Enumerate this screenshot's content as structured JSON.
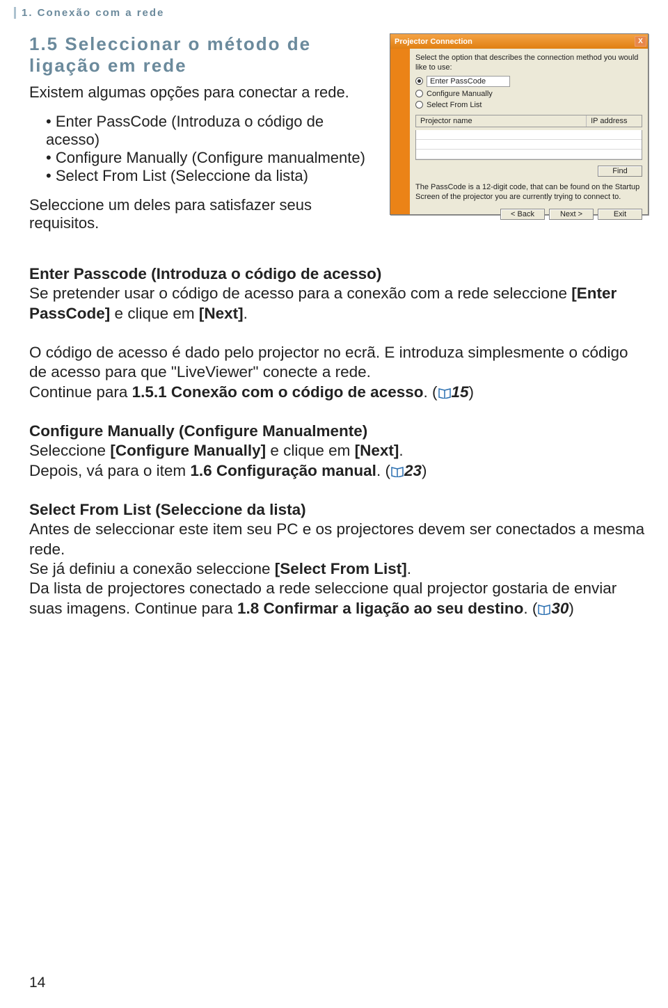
{
  "breadcrumb": "1. Conexão com a rede",
  "heading": "1.5 Seleccionar o método de ligação em rede",
  "intro": "Existem algumas opções para conectar a rede.",
  "bullets": [
    "Enter PassCode (Introduza o código de acesso)",
    "Configure Manually (Configure manualmente)",
    "Select From List (Seleccione da lista)"
  ],
  "after_bullets": "Seleccione um deles para satisfazer seus requisitos.",
  "dialog": {
    "title": "Projector Connection",
    "close": "X",
    "prompt": "Select the option that describes the connection method you would like to use:",
    "opt1": "Enter PassCode",
    "opt2": "Configure Manually",
    "opt3": "Select From List",
    "col1": "Projector name",
    "col2": "IP address",
    "find": "Find",
    "note": "The PassCode is a 12-digit code, that can be found on the Startup Screen of the projector you are currently trying to connect to.",
    "back": "< Back",
    "next": "Next >",
    "exit": "Exit"
  },
  "sec1_title": "Enter Passcode (Introduza o código de acesso)",
  "sec1_body_a": "Se pretender usar o código de acesso para a conexão com a rede seleccione ",
  "sec1_body_b": "[Enter PassCode]",
  "sec1_body_c": " e clique em ",
  "sec1_body_d": "[Next]",
  "sec1_body_e": ".",
  "sec1_p2_a": "O código de acesso é dado pelo projector no ecrã. E introduza simplesmente o código de acesso para que \"LiveViewer\" conecte a rede.",
  "sec1_p2_b": "Continue para ",
  "sec1_p2_c": "1.5.1 Conexão com o código de acesso",
  "sec1_p2_d": ". (",
  "sec1_p2_ref": "15",
  "sec1_p2_e": ")",
  "sec2_title": "Configure Manually (Configure Manualmente)",
  "sec2_a": "Seleccione ",
  "sec2_b": "[Configure Manually]",
  "sec2_c": " e clique em ",
  "sec2_d": "[Next]",
  "sec2_e": ".",
  "sec2_f": "Depois, vá para o item ",
  "sec2_g": "1.6 Configuração manual",
  "sec2_h": ". (",
  "sec2_ref": "23",
  "sec2_i": ")",
  "sec3_title": "Select From List (Seleccione da lista)",
  "sec3_a": "Antes de seleccionar este item seu PC e os projectores devem ser conectados a mesma rede.",
  "sec3_b": "Se já definiu a conexão seleccione ",
  "sec3_c": "[Select From List]",
  "sec3_d": ".",
  "sec3_e": "Da lista de projectores conectado a rede seleccione qual projector gostaria de enviar suas imagens. Continue para ",
  "sec3_f": "1.8 Confirmar a ligação ao seu destino",
  "sec3_g": ". (",
  "sec3_ref": "30",
  "sec3_h": ")",
  "page_number": "14"
}
